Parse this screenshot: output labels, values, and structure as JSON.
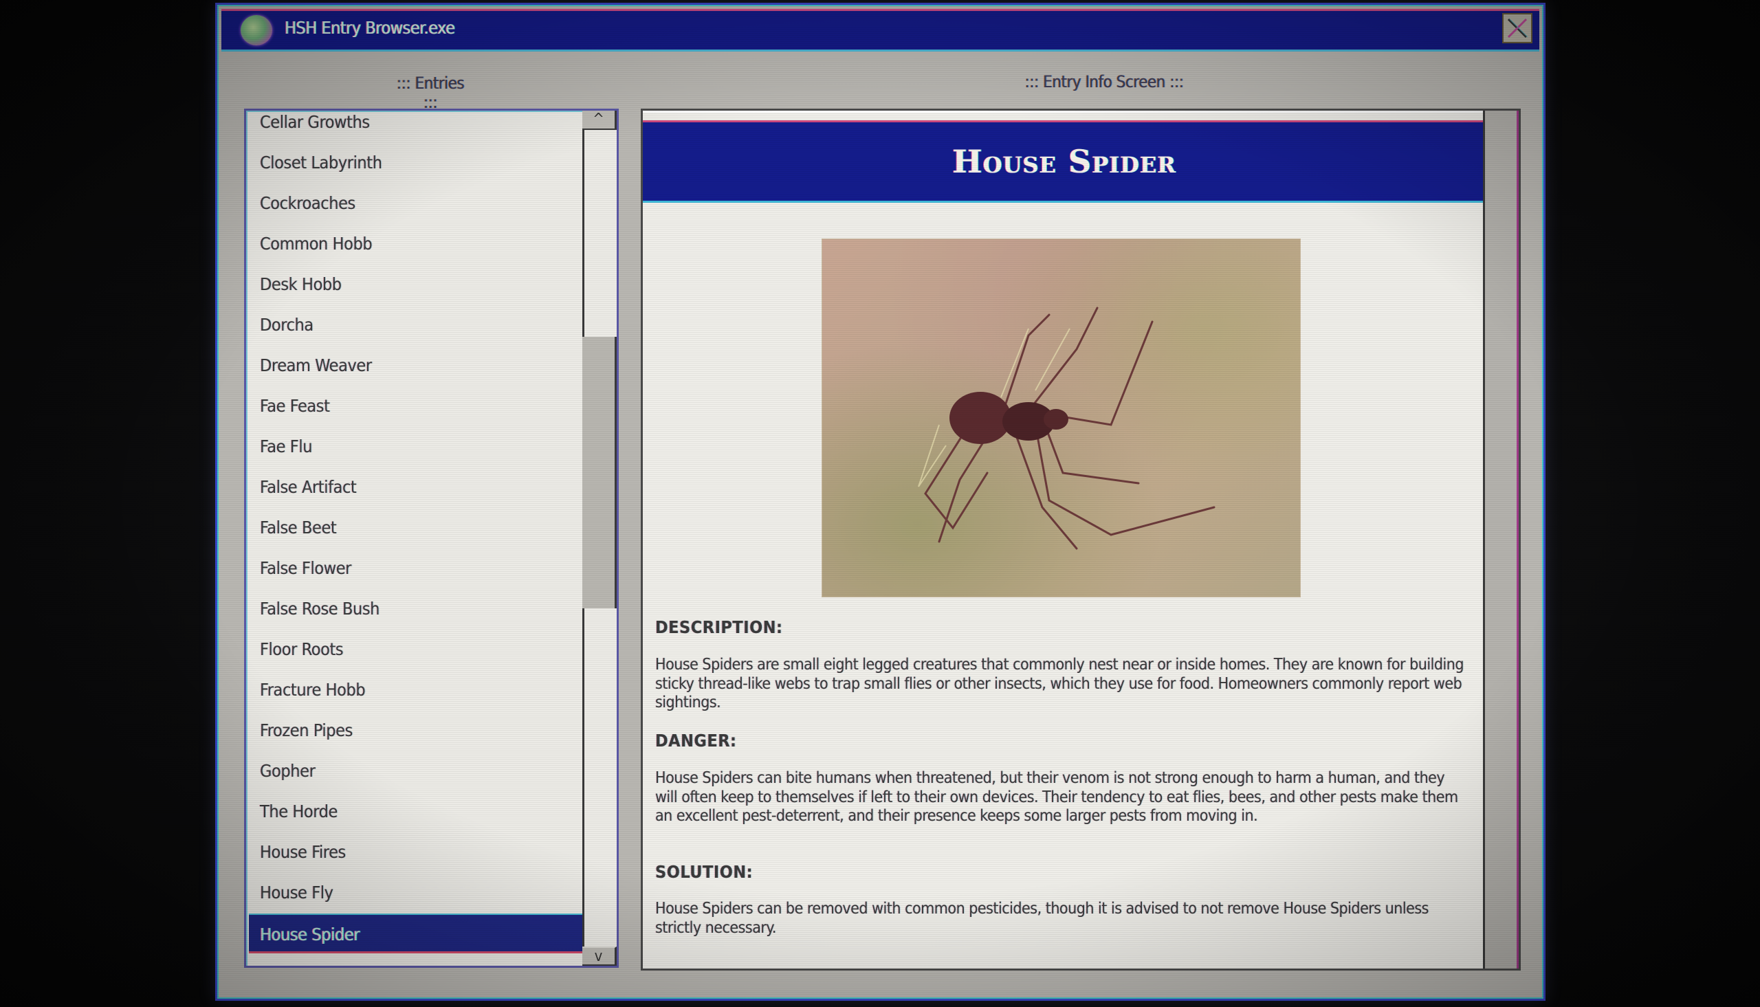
{
  "window": {
    "title": "HSH Entry Browser.exe",
    "app_icon": "globe-icon",
    "close_icon": "close-x-icon"
  },
  "entries_panel": {
    "label": "::: Entries :::",
    "items": [
      "Cellar Growths",
      "Closet Labyrinth",
      "Cockroaches",
      "Common Hobb",
      "Desk Hobb",
      "Dorcha",
      "Dream Weaver",
      "Fae Feast",
      "Fae Flu",
      "False Artifact",
      "False Beet",
      "False Flower",
      "False Rose Bush",
      "Floor Roots",
      "Fracture Hobb",
      "Frozen Pipes",
      "Gopher",
      "The Horde",
      "House Fires",
      "House Fly",
      "House Spider"
    ],
    "selected": "House Spider",
    "scroll_up": "^",
    "scroll_down": "v",
    "scroll_position_fraction": 0.38
  },
  "info_panel": {
    "label": "::: Entry Info Screen :::",
    "title": "House Spider",
    "image_alt": "spider-photo",
    "sections": [
      {
        "heading": "DESCRIPTION:",
        "body": "House Spiders are small eight legged creatures that commonly nest near or inside homes. They are known for building sticky thread-like webs to trap small flies or other insects, which they use for food. Homeowners commonly report web sightings."
      },
      {
        "heading": "DANGER:",
        "body": "House Spiders can bite humans when threatened, but their venom is not strong enough to harm a human, and they will often keep to themselves if left to their own devices. Their tendency to eat flies, bees, and other pests make them an excellent pest-deterrent, and their presence keeps some larger pests from moving in."
      },
      {
        "heading": "SOLUTION:",
        "body": "House Spiders can be removed with common pesticides, though it is advised to not remove House Spiders unless strictly necessary."
      }
    ]
  },
  "colors": {
    "titlebar": "#141a86",
    "selection": "#1f2781",
    "window_bg": "#b9b7b2",
    "list_bg": "#ecebe6"
  }
}
